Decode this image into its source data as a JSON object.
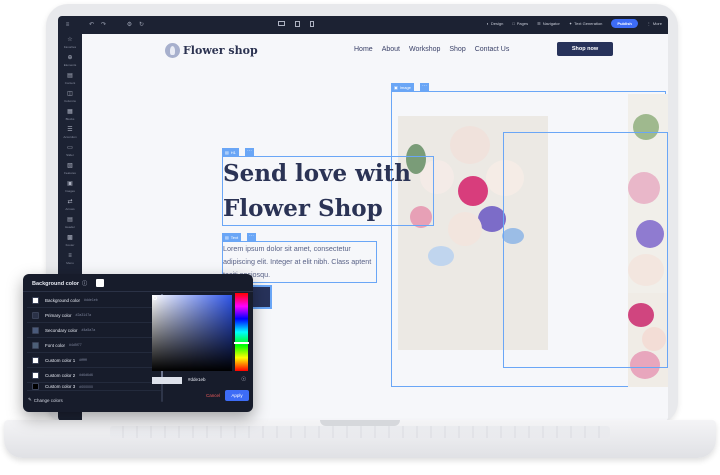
{
  "editor": {
    "topbar": {
      "device_icons": [
        "desktop-icon",
        "tablet-icon",
        "mobile-icon"
      ],
      "design": "Design",
      "pages": "Pages",
      "navigator": "Navigator",
      "text_generation": "Text Generation",
      "publish": "Publish",
      "more": "More"
    },
    "sidebar": [
      {
        "label": "Favorites",
        "icon": "star-icon"
      },
      {
        "label": "Elements",
        "icon": "plus-circle-icon"
      },
      {
        "label": "Content",
        "icon": "document-icon"
      },
      {
        "label": "Columns",
        "icon": "columns-icon"
      },
      {
        "label": "Blocks",
        "icon": "blocks-icon"
      },
      {
        "label": "Accordion",
        "icon": "accordion-icon"
      },
      {
        "label": "Slider",
        "icon": "slider-icon"
      },
      {
        "label": "Features",
        "icon": "features-icon"
      },
      {
        "label": "Images",
        "icon": "image-icon"
      },
      {
        "label": "Arrows",
        "icon": "arrows-icon"
      },
      {
        "label": "Header",
        "icon": "header-icon"
      },
      {
        "label": "Footer",
        "icon": "footer-icon"
      },
      {
        "label": "Menu",
        "icon": "menu-icon"
      }
    ]
  },
  "site": {
    "logo": "Flower shop",
    "nav": [
      "Home",
      "About",
      "Workshop",
      "Shop",
      "Contact Us"
    ],
    "shop_now": "Shop now",
    "hero_title": "Send love with Flower Shop",
    "hero_text": "Lorem ipsum dolor sit amet, consectetur adipiscing elit. Integer at elit nibh. Class aptent taciti sociosqu.",
    "tags": {
      "h1": "H1",
      "text": "Text",
      "image": "Image"
    }
  },
  "picker": {
    "title": "Background color",
    "colors": [
      {
        "name": "Background color",
        "hex": "#dde1eb",
        "swatch": "#ffffff"
      },
      {
        "name": "Primary color",
        "hex": "#2a3147a",
        "swatch": "#2a3147"
      },
      {
        "name": "Secondary color",
        "hex": "#4a5a7a",
        "swatch": "#4a5a7a"
      },
      {
        "name": "Font color",
        "hex": "#4d5f77",
        "swatch": "#4d5f77"
      },
      {
        "name": "Custom color 1",
        "hex": "#ffffff",
        "swatch": "#ffffff"
      },
      {
        "name": "Custom color 2",
        "hex": "#d6d6d6",
        "swatch": "#ffffff"
      },
      {
        "name": "Custom color 3",
        "hex": "#000000",
        "swatch": "#000000"
      }
    ],
    "change_colors": "Change colors",
    "hex_value": "#dde1eb",
    "cancel": "Cancel",
    "apply": "Apply"
  }
}
